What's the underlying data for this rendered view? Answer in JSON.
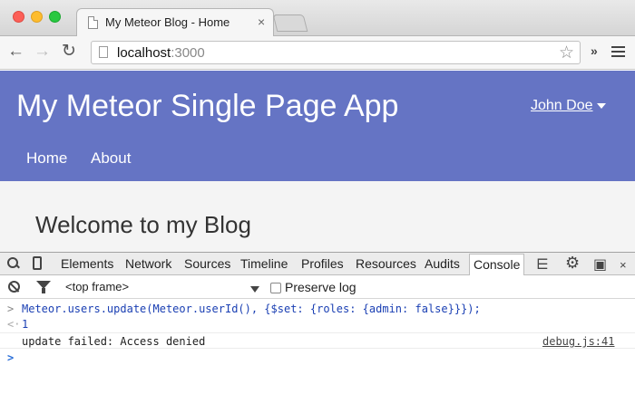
{
  "browser": {
    "tab_title": "My Meteor Blog - Home",
    "tab_close": "×",
    "url_host": "localhost",
    "url_port": ":3000",
    "bookmark_star": "☆",
    "extensions_more": "»",
    "back": "←",
    "forward": "→",
    "reload": "↻"
  },
  "header": {
    "app_title": "My Meteor Single Page App",
    "user_menu": "John Doe",
    "nav": [
      {
        "label": "Home"
      },
      {
        "label": "About"
      }
    ]
  },
  "main": {
    "heading": "Welcome to my Blog"
  },
  "devtools": {
    "tabs": [
      {
        "label": "Elements"
      },
      {
        "label": "Network"
      },
      {
        "label": "Sources"
      },
      {
        "label": "Timeline"
      },
      {
        "label": "Profiles"
      },
      {
        "label": "Resources"
      },
      {
        "label": "Audits"
      },
      {
        "label": "Console"
      }
    ],
    "active_tab": "Console",
    "right_icons": {
      "execute": "⋿",
      "settings": "⚙",
      "dock": "▣",
      "close": "×"
    },
    "frame_select": "<top frame>",
    "preserve_log": "Preserve log",
    "console": {
      "input_prompt": ">",
      "output_prompt": "<·",
      "command": "Meteor.users.update(Meteor.userId(), {$set: {roles: {admin: false}}});",
      "result": "1",
      "error_message": "update failed: Access denied",
      "error_source": "debug.js:41",
      "caret": ">"
    }
  }
}
